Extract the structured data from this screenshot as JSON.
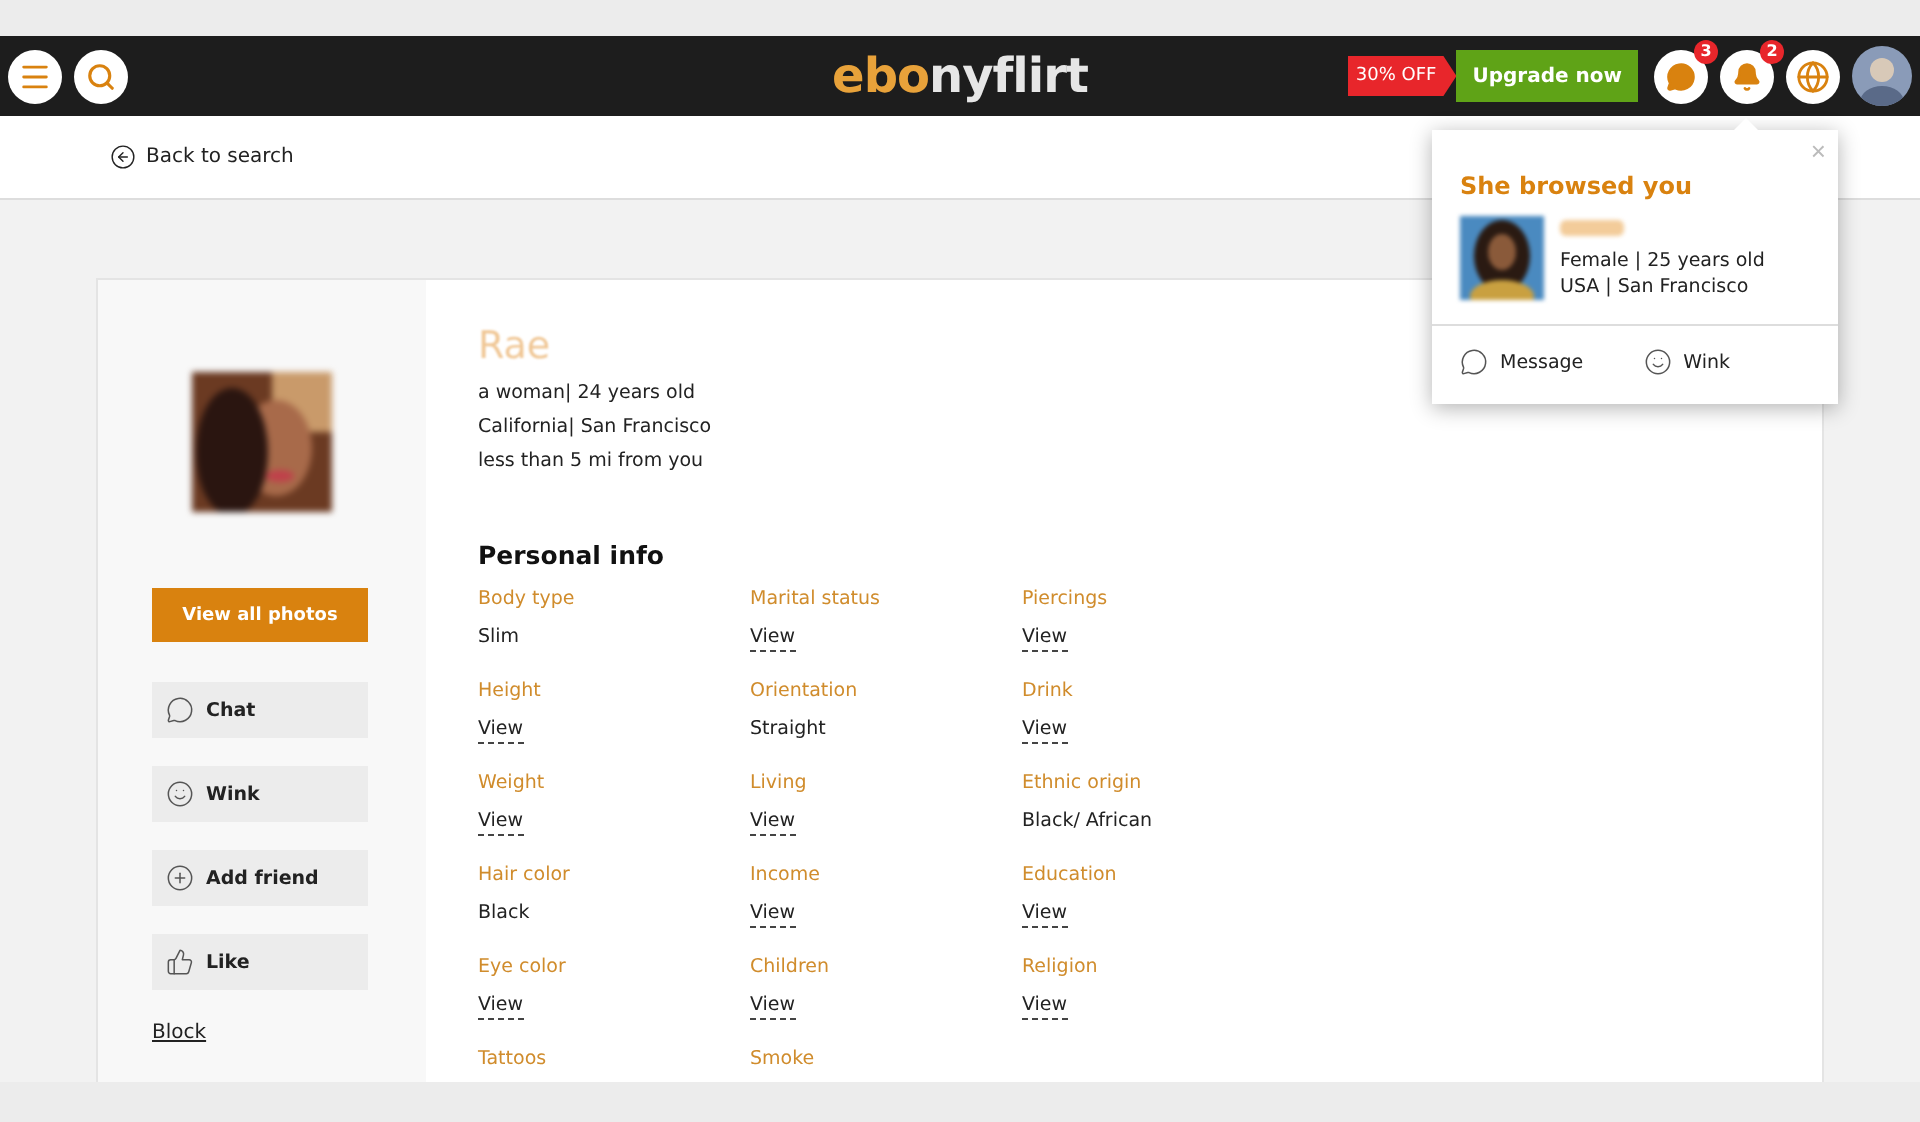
{
  "header": {
    "logo": [
      {
        "text": "ebo",
        "color": "#e8a23a"
      },
      {
        "text": "nyflirt",
        "color": "#e6e6e6"
      }
    ],
    "promo": "30% OFF",
    "upgrade": "Upgrade now",
    "messages_count": "3",
    "notifications_count": "2"
  },
  "back_link": "Back to search",
  "profile": {
    "name": "Rae",
    "lines": [
      "a woman| 24 years old",
      "California| San Francisco",
      "less than 5 mi from you"
    ]
  },
  "sidebar": {
    "photos_button": "View all photos",
    "actions": [
      {
        "kind": "chat",
        "label": "Chat"
      },
      {
        "kind": "wink",
        "label": "Wink"
      },
      {
        "kind": "add",
        "label": "Add friend"
      },
      {
        "kind": "like",
        "label": "Like"
      }
    ],
    "block": "Block"
  },
  "personal_info": {
    "title": "Personal info",
    "columns": [
      [
        {
          "label": "Body type",
          "value": "Slim",
          "link": false
        },
        {
          "label": "Height",
          "value": "View",
          "link": true
        },
        {
          "label": "Weight",
          "value": "View",
          "link": true
        },
        {
          "label": "Hair color",
          "value": "Black",
          "link": false
        },
        {
          "label": "Eye color",
          "value": "View",
          "link": true
        },
        {
          "label": "Tattoos"
        }
      ],
      [
        {
          "label": "Marital status",
          "value": "View",
          "link": true
        },
        {
          "label": "Orientation",
          "value": "Straight",
          "link": false
        },
        {
          "label": "Living",
          "value": "View",
          "link": true
        },
        {
          "label": "Income",
          "value": "View",
          "link": true
        },
        {
          "label": "Children",
          "value": "View",
          "link": true
        },
        {
          "label": "Smoke"
        }
      ],
      [
        {
          "label": "Piercings",
          "value": "View",
          "link": true
        },
        {
          "label": "Drink",
          "value": "View",
          "link": true
        },
        {
          "label": "Ethnic origin",
          "value": "Black/ African",
          "link": false
        },
        {
          "label": "Education",
          "value": "View",
          "link": true
        },
        {
          "label": "Religion",
          "value": "View",
          "link": true
        }
      ]
    ]
  },
  "popup": {
    "title": "She browsed you",
    "lines": [
      "Female | 25 years old",
      "USA | San Francisco"
    ],
    "close": "×",
    "actions": [
      {
        "kind": "message",
        "label": "Message"
      },
      {
        "kind": "wink",
        "label": "Wink"
      }
    ]
  }
}
